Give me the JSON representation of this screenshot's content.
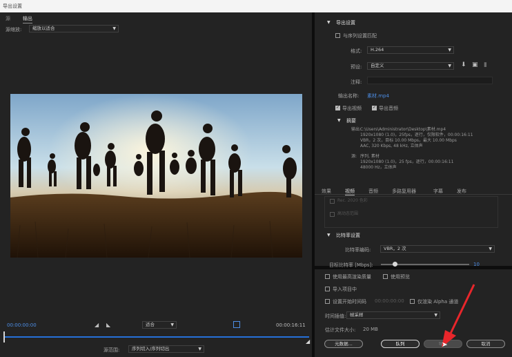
{
  "window": {
    "title": "导出设置"
  },
  "tabs": [
    {
      "label": "源"
    },
    {
      "label": "输出"
    }
  ],
  "source_scaling": {
    "label": "源缩放:",
    "value": "缩放以适合"
  },
  "timecode": {
    "start": "00:00:00:00",
    "end": "00:00:16:11"
  },
  "fit": {
    "value": "适合"
  },
  "source_range": {
    "label": "源范围:",
    "value": "序列切入/序列切出"
  },
  "export_settings": {
    "title": "导出设置",
    "match_sequence": "与序列设置匹配",
    "format_label": "格式:",
    "format_value": "H.264",
    "preset_label": "预设:",
    "preset_value": "自定义",
    "comments_label": "注释:",
    "output_name_label": "输出名称:",
    "output_name_value": "素材.mp4",
    "export_video": "导出视频",
    "export_audio": "导出音频",
    "summary_title": "摘要",
    "summary_output_label": "输出:",
    "summary_output_lines": [
      "C:\\Users\\Administrator\\Desktop\\素材.mp4",
      "1920x1080 (1.0)，25fps，逐行，仅限软件，00:00:16:11",
      "VBR，2 次，目标 10.00 Mbps，最大 10.00 Mbps",
      "AAC, 320 Kbps, 48 kHz, 立体声"
    ],
    "summary_source_label": "源:",
    "summary_source_lines": [
      "序列, 素材",
      "1920x1080 (1.0)，25 fps，逐行，00:00:16:11",
      "48000 Hz，立体声"
    ]
  },
  "settings_tabs": [
    {
      "label": "效果"
    },
    {
      "label": "视频"
    },
    {
      "label": "音频"
    },
    {
      "label": "多路复用器"
    },
    {
      "label": "字幕"
    },
    {
      "label": "发布"
    }
  ],
  "faded_options": [
    "Rec. 2020 色彩",
    "高动态范围"
  ],
  "bitrate": {
    "title": "比特率设置",
    "encoding_label": "比特率编码:",
    "encoding_value": "VBR，2 次",
    "target_label": "目标比特率 [Mbps]:",
    "target_value": "10",
    "target_fraction": 0.16
  },
  "options": {
    "max_render_quality": "使用最高渲染质量",
    "use_previews": "使用预览",
    "import_into_project": "导入项目中",
    "set_start_timecode": "设置开始时间码",
    "start_timecode_value": "00:00:00:00",
    "render_alpha_only": "仅渲染 Alpha 通道",
    "time_interpolation_label": "时间插值:",
    "time_interpolation_value": "帧采样",
    "estimated_size_label": "估计文件大小:",
    "estimated_size_value": "20 MB"
  },
  "buttons": {
    "metadata": "元数据...",
    "queue": "队列",
    "export": "导出",
    "cancel": "取消"
  },
  "colors": {
    "accent_blue": "#4d8ee6",
    "annotation_red": "#e8262b"
  }
}
